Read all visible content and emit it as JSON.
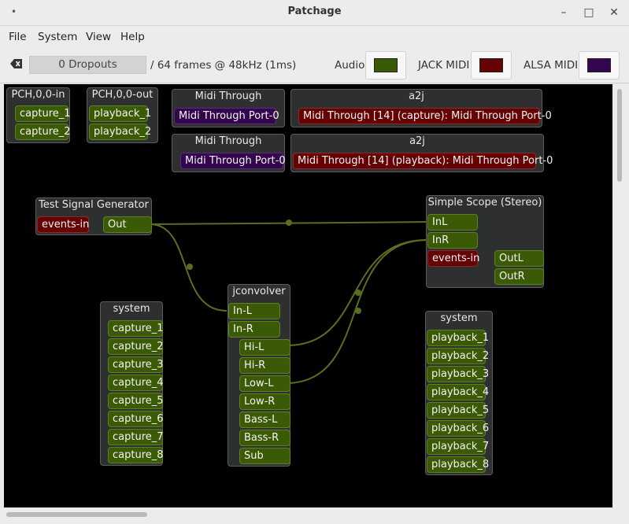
{
  "window": {
    "title": "Patchage",
    "minimize_glyph": "–",
    "maximize_glyph": "□",
    "close_glyph": "✕"
  },
  "menu": [
    "File",
    "System",
    "View",
    "Help"
  ],
  "toolbar": {
    "clear_icon": "backspace-clear-icon",
    "dropouts": "0 Dropouts",
    "frames": "/ 64 frames @ 48kHz (1ms)",
    "audio_label": "Audio",
    "jack_midi_label": "JACK MIDI",
    "alsa_midi_label": "ALSA MIDI",
    "audio_color": "#3b5a06",
    "jack_midi_color": "#650202",
    "alsa_midi_color": "#33064d"
  },
  "modules": {
    "pch_in": {
      "title": "PCH,0,0-in",
      "ports": [
        "capture_1",
        "capture_2"
      ]
    },
    "pch_out": {
      "title": "PCH,0,0-out",
      "ports": [
        "playback_1",
        "playback_2"
      ]
    },
    "midi_through_1": {
      "title": "Midi Through",
      "ports": [
        "Midi Through Port-0"
      ]
    },
    "a2j_1": {
      "title": "a2j",
      "ports": [
        "Midi Through [14] (capture): Midi Through Port-0"
      ]
    },
    "midi_through_2": {
      "title": "Midi Through",
      "ports": [
        "Midi Through Port-0"
      ]
    },
    "a2j_2": {
      "title": "a2j",
      "ports": [
        "Midi Through [14] (playback): Midi Through Port-0"
      ]
    },
    "test_signal": {
      "title": "Test Signal Generator",
      "ports": [
        "events-in",
        "Out"
      ]
    },
    "simple_scope": {
      "title": "Simple Scope (Stereo)",
      "ports": [
        "InL",
        "InR",
        "events-in",
        "OutL",
        "OutR"
      ]
    },
    "jconvolver": {
      "title": "jconvolver",
      "ports": [
        "In-L",
        "In-R",
        "Hi-L",
        "Hi-R",
        "Low-L",
        "Low-R",
        "Bass-L",
        "Bass-R",
        "Sub"
      ]
    },
    "system_capture": {
      "title": "system",
      "ports": [
        "capture_1",
        "capture_2",
        "capture_3",
        "capture_4",
        "capture_5",
        "capture_6",
        "capture_7",
        "capture_8"
      ]
    },
    "system_playback": {
      "title": "system",
      "ports": [
        "playback_1",
        "playback_2",
        "playback_3",
        "playback_4",
        "playback_5",
        "playback_6",
        "playback_7",
        "playback_8"
      ]
    }
  }
}
